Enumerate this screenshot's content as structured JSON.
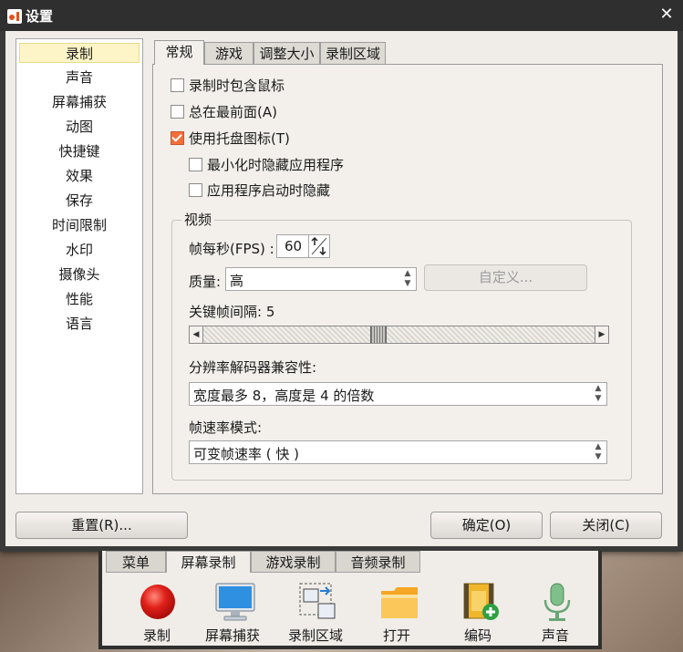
{
  "window": {
    "title": "设置",
    "close_symbol": "✕"
  },
  "nav": {
    "items": [
      "录制",
      "声音",
      "屏幕捕获",
      "动图",
      "快捷键",
      "效果",
      "保存",
      "时间限制",
      "水印",
      "摄像头",
      "性能",
      "语言"
    ],
    "selected": "录制"
  },
  "tabs": [
    "常规",
    "游戏",
    "调整大小",
    "录制区域"
  ],
  "general": {
    "chk_mouse": "录制时包含鼠标",
    "chk_topmost": "总在最前面(A)",
    "chk_tray": "使用托盘图标(T)",
    "chk_hide_min": "最小化时隐藏应用程序",
    "chk_hide_start": "应用程序启动时隐藏",
    "checked": {
      "chk_mouse": false,
      "chk_topmost": false,
      "chk_tray": true,
      "chk_hide_min": false,
      "chk_hide_start": false
    }
  },
  "video": {
    "group_title": "视频",
    "fps_label": "帧每秒(FPS) :",
    "fps_value": "60",
    "quality_label": "质量:",
    "quality_value": "高",
    "custom_button": "自定义...",
    "keyframe_label": "关键帧间隔: 5",
    "keyframe_value": 5,
    "res_label": "分辨率解码器兼容性:",
    "res_value": "宽度最多 8，高度是 4 的倍数",
    "ratemode_label": "帧速率模式:",
    "ratemode_value": "可变帧速率 ( 快 )"
  },
  "buttons": {
    "reset": "重置(R)...",
    "ok": "确定(O)",
    "close": "关闭(C)"
  },
  "toolbar": {
    "tabs": [
      "菜单",
      "屏幕录制",
      "游戏录制",
      "音频录制"
    ],
    "active_tab": "屏幕录制",
    "tools": [
      "录制",
      "屏幕捕获",
      "录制区域",
      "打开",
      "编码",
      "声音"
    ]
  }
}
